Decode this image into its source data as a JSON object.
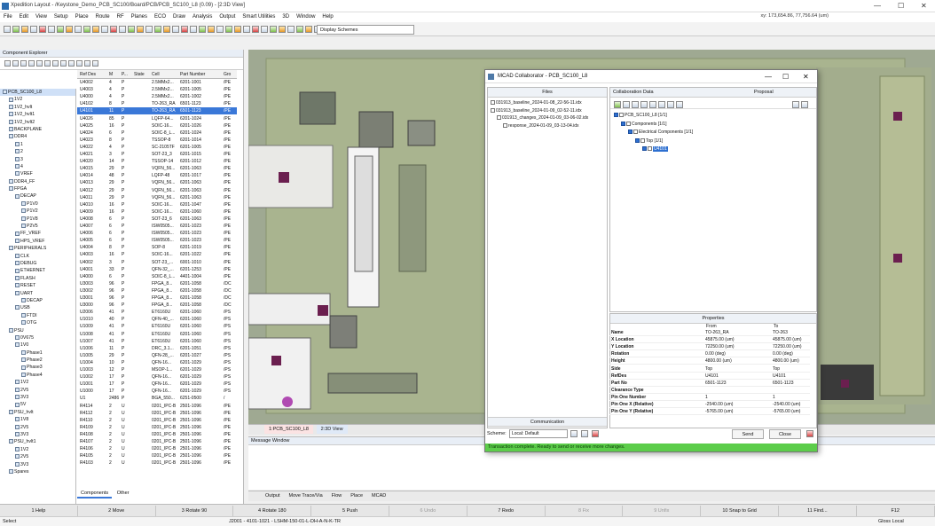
{
  "app": {
    "title": "Xpedition Layout - /Keystone_Demo_PCB_SC100/Board/PCB/PCB_SC100_L8 (0.09) - [2:3D View]",
    "coords": "xy: 173,654.86, 77,756.64 (um)",
    "min": "—",
    "max": "☐",
    "close": "✕"
  },
  "menu": [
    "File",
    "Edit",
    "View",
    "Setup",
    "Place",
    "Route",
    "RF",
    "Planes",
    "ECO",
    "Draw",
    "Analysis",
    "Output",
    "Smart Utilities",
    "3D",
    "Window",
    "Help"
  ],
  "toolbar": {
    "schemes": "Display Schemes"
  },
  "component_explorer": {
    "title": "Component Explorer",
    "tree": [
      {
        "label": "PCB_SC100_L8",
        "indent": 0,
        "selected": true
      },
      {
        "label": "1V2",
        "indent": 1
      },
      {
        "label": "1V2_hvlt",
        "indent": 1
      },
      {
        "label": "1V2_hvlt1",
        "indent": 1
      },
      {
        "label": "1V2_hvlt2",
        "indent": 1
      },
      {
        "label": "BACKPLANE",
        "indent": 1
      },
      {
        "label": "DDR4",
        "indent": 1
      },
      {
        "label": "1",
        "indent": 2
      },
      {
        "label": "2",
        "indent": 2
      },
      {
        "label": "3",
        "indent": 2
      },
      {
        "label": "4",
        "indent": 2
      },
      {
        "label": "VREF",
        "indent": 2
      },
      {
        "label": "DDR4_FF",
        "indent": 1
      },
      {
        "label": "FPGA",
        "indent": 1
      },
      {
        "label": "DECAP",
        "indent": 2
      },
      {
        "label": "P1V0",
        "indent": 3
      },
      {
        "label": "P1V2",
        "indent": 3
      },
      {
        "label": "P1V8",
        "indent": 3
      },
      {
        "label": "P2V5",
        "indent": 3
      },
      {
        "label": "FF_VREF",
        "indent": 2
      },
      {
        "label": "HPS_VREF",
        "indent": 2
      },
      {
        "label": "PERIPHERALS",
        "indent": 1
      },
      {
        "label": "CLK",
        "indent": 2
      },
      {
        "label": "DEBUG",
        "indent": 2
      },
      {
        "label": "ETHERNET",
        "indent": 2
      },
      {
        "label": "FLASH",
        "indent": 2
      },
      {
        "label": "RESET",
        "indent": 2
      },
      {
        "label": "UART",
        "indent": 2
      },
      {
        "label": "DECAP",
        "indent": 3
      },
      {
        "label": "USB",
        "indent": 2
      },
      {
        "label": "FTDI",
        "indent": 3
      },
      {
        "label": "OTG",
        "indent": 3
      },
      {
        "label": "PSU",
        "indent": 1
      },
      {
        "label": "0V675",
        "indent": 2
      },
      {
        "label": "1V0",
        "indent": 2
      },
      {
        "label": "Phase1",
        "indent": 3
      },
      {
        "label": "Phase2",
        "indent": 3
      },
      {
        "label": "Phase3",
        "indent": 3
      },
      {
        "label": "Phase4",
        "indent": 3
      },
      {
        "label": "1V2",
        "indent": 2
      },
      {
        "label": "2V5",
        "indent": 2
      },
      {
        "label": "3V3",
        "indent": 2
      },
      {
        "label": "5V",
        "indent": 2
      },
      {
        "label": "PSU_hvlt",
        "indent": 1
      },
      {
        "label": "1V8",
        "indent": 2
      },
      {
        "label": "2V5",
        "indent": 2
      },
      {
        "label": "3V3",
        "indent": 2
      },
      {
        "label": "PSU_hvlt1",
        "indent": 1
      },
      {
        "label": "1V2",
        "indent": 2
      },
      {
        "label": "2V5",
        "indent": 2
      },
      {
        "label": "3V3",
        "indent": 2
      },
      {
        "label": "Spares",
        "indent": 1
      }
    ],
    "columns": [
      "Ref Des",
      "M",
      "P...",
      "State",
      "Cell",
      "Part Number",
      "Gro"
    ],
    "rows": [
      [
        "U4002",
        "4",
        "P",
        "",
        "2.5MMx2...",
        "6201-1001",
        "/PE"
      ],
      [
        "U4003",
        "4",
        "P",
        "",
        "2.5MMx2...",
        "6201-1005",
        "/PE"
      ],
      [
        "U4000",
        "4",
        "P",
        "",
        "2.5MMx2...",
        "6201-1002",
        "/PE"
      ],
      [
        "U4102",
        "8",
        "P",
        "",
        "TO-263_RA",
        "6501-1123",
        "/PE"
      ],
      [
        "U4101",
        "11",
        "P",
        "",
        "TO-263_RA",
        "6501-1123",
        "/PE"
      ],
      [
        "U4026",
        "85",
        "P",
        "",
        "LQFP-64...",
        "6201-1024",
        "/PE"
      ],
      [
        "U4025",
        "16",
        "P",
        "",
        "SOIC-16...",
        "6201-1026",
        "/PE"
      ],
      [
        "U4024",
        "6",
        "P",
        "",
        "SOIC-8_L...",
        "6201-1024",
        "/PE"
      ],
      [
        "U4023",
        "8",
        "P",
        "",
        "TSSOP-8",
        "6201-1014",
        "/PE"
      ],
      [
        "U4022",
        "4",
        "P",
        "",
        "SC-2105TF",
        "6201-1005",
        "/PE"
      ],
      [
        "U4021",
        "3",
        "P",
        "",
        "SOT-23_3",
        "6201-1015",
        "/PE"
      ],
      [
        "U4020",
        "14",
        "P",
        "",
        "TSSOP-14",
        "6201-1012",
        "/PE"
      ],
      [
        "U4015",
        "29",
        "P",
        "",
        "VQFN_56...",
        "6201-1063",
        "/PE"
      ],
      [
        "U4014",
        "48",
        "P",
        "",
        "LQFP-48",
        "6201-1017",
        "/PE"
      ],
      [
        "U4013",
        "29",
        "P",
        "",
        "VQFN_56...",
        "6201-1063",
        "/PE"
      ],
      [
        "U4012",
        "29",
        "P",
        "",
        "VQFN_56...",
        "6201-1063",
        "/PE"
      ],
      [
        "U4011",
        "29",
        "P",
        "",
        "VQFN_56...",
        "6201-1063",
        "/PE"
      ],
      [
        "U4010",
        "16",
        "P",
        "",
        "SOIC-16...",
        "6201-1047",
        "/PE"
      ],
      [
        "U4009",
        "16",
        "P",
        "",
        "SOIC-16...",
        "6201-1060",
        "/PE"
      ],
      [
        "U4008",
        "6",
        "P",
        "",
        "SOT-23_6",
        "6201-1063",
        "/PE"
      ],
      [
        "U4007",
        "6",
        "P",
        "",
        "ISW0505...",
        "6201-1023",
        "/PE"
      ],
      [
        "U4006",
        "6",
        "P",
        "",
        "ISW0505...",
        "6201-1023",
        "/PE"
      ],
      [
        "U4005",
        "6",
        "P",
        "",
        "ISW0505...",
        "6201-1023",
        "/PE"
      ],
      [
        "U4004",
        "8",
        "P",
        "",
        "SOP-8",
        "6201-1019",
        "/PE"
      ],
      [
        "U4003",
        "16",
        "P",
        "",
        "SOIC-16...",
        "6201-1022",
        "/PE"
      ],
      [
        "U4002",
        "3",
        "P",
        "",
        "SOT-23_...",
        "6001-1010",
        "/PE"
      ],
      [
        "U4001",
        "33",
        "P",
        "",
        "QFN-32_...",
        "6201-1253",
        "/PE"
      ],
      [
        "U4000",
        "6",
        "P",
        "",
        "SOIC-8_L...",
        "4401-1004",
        "/PE"
      ],
      [
        "U3003",
        "96",
        "P",
        "",
        "FPGA_8...",
        "6201-1058",
        "/DC"
      ],
      [
        "U3002",
        "96",
        "P",
        "",
        "FPGA_8...",
        "6201-1058",
        "/DC"
      ],
      [
        "U3001",
        "96",
        "P",
        "",
        "FPGA_8...",
        "6201-1058",
        "/DC"
      ],
      [
        "U3000",
        "96",
        "P",
        "",
        "FPGA_8...",
        "6201-1058",
        "/DC"
      ],
      [
        "U2006",
        "41",
        "P",
        "",
        "ET6160U",
        "6201-1060",
        "/PS"
      ],
      [
        "U1010",
        "40",
        "P",
        "",
        "QFN-40_...",
        "6201-1060",
        "/PS"
      ],
      [
        "U1009",
        "41",
        "P",
        "",
        "ET6160U",
        "6201-1060",
        "/PS"
      ],
      [
        "U1008",
        "41",
        "P",
        "",
        "ET6160U",
        "6201-1060",
        "/PS"
      ],
      [
        "U1007",
        "41",
        "P",
        "",
        "ET6160U",
        "6201-1060",
        "/PS"
      ],
      [
        "U1006",
        "11",
        "P",
        "",
        "DRC_3.1...",
        "6201-1051",
        "/PS"
      ],
      [
        "U1005",
        "29",
        "P",
        "",
        "QFN-28_...",
        "6201-1027",
        "/PS"
      ],
      [
        "U1004",
        "10",
        "P",
        "",
        "QFN-16...",
        "6201-1029",
        "/PS"
      ],
      [
        "U1003",
        "12",
        "P",
        "",
        "MSOP-1...",
        "6201-1029",
        "/PS"
      ],
      [
        "U1002",
        "17",
        "P",
        "",
        "QFN-16...",
        "6201-1029",
        "/PS"
      ],
      [
        "U1001",
        "17",
        "P",
        "",
        "QFN-16...",
        "6201-1029",
        "/PS"
      ],
      [
        "U1000",
        "17",
        "P",
        "",
        "QFN-16...",
        "6201-1029",
        "/PS"
      ],
      [
        "U1",
        "2486",
        "P",
        "",
        "BGA_550...",
        "6251-0500",
        "/"
      ],
      [
        "R4114",
        "2",
        "U",
        "",
        "0201_IPC-B",
        "2501-1096",
        "/PE"
      ],
      [
        "R4112",
        "2",
        "U",
        "",
        "0201_IPC-B",
        "2501-1096",
        "/PE"
      ],
      [
        "R4110",
        "2",
        "U",
        "",
        "0201_IPC-B",
        "2501-1096",
        "/PE"
      ],
      [
        "R4109",
        "2",
        "U",
        "",
        "0201_IPC-B",
        "2501-1096",
        "/PE"
      ],
      [
        "R4108",
        "2",
        "U",
        "",
        "0201_IPC-B",
        "2501-1096",
        "/PE"
      ],
      [
        "R4107",
        "2",
        "U",
        "",
        "0201_IPC-B",
        "2501-1096",
        "/PE"
      ],
      [
        "R4106",
        "2",
        "U",
        "",
        "0201_IPC-B",
        "2501-1096",
        "/PE"
      ],
      [
        "R4105",
        "2",
        "U",
        "",
        "0201_IPC-B",
        "2501-1096",
        "/PE"
      ],
      [
        "R4103",
        "2",
        "U",
        "",
        "0201_IPC-B",
        "2501-1096",
        "/PE"
      ]
    ],
    "selected_row": 4,
    "tabs": [
      "Components",
      "Other"
    ]
  },
  "view_tabs": [
    "1:PCB_SC100_L8",
    "2:3D View"
  ],
  "message_window": {
    "title": "Message Window"
  },
  "bottom_tabs": [
    "Output",
    "Move Trace/Via",
    "Flow",
    "Place",
    "MCAD"
  ],
  "fkeys": [
    {
      "label": "1 Help",
      "dim": false
    },
    {
      "label": "2 Move",
      "dim": false
    },
    {
      "label": "3 Rotate 90",
      "dim": false
    },
    {
      "label": "4 Rotate 180",
      "dim": false
    },
    {
      "label": "5 Push",
      "dim": false
    },
    {
      "label": "6 Undo",
      "dim": true
    },
    {
      "label": "7 Redo",
      "dim": false
    },
    {
      "label": "8 Fix",
      "dim": true
    },
    {
      "label": "9 Unfix",
      "dim": true
    },
    {
      "label": "10 Snap to Grid",
      "dim": false
    },
    {
      "label": "11 Find...",
      "dim": false
    },
    {
      "label": "F12",
      "dim": false
    }
  ],
  "status": {
    "left": "Select",
    "middle": "J2001 - 4101-1021 - LSHM-150-01-L-DH-A-N-K-TR",
    "right": "Gloss Local"
  },
  "mcad": {
    "title": "MCAD Collaborator - PCB_SC100_L8",
    "files_header": "Files",
    "files": [
      {
        "label": "031913_baseline_2024-01-08_22-56-11.idx",
        "indent": 0
      },
      {
        "label": "031913_baseline_2024-01-09_02-52-11.idx",
        "indent": 0
      },
      {
        "label": "031913_changes_2024-01-09_03-06-02.idx",
        "indent": 1
      },
      {
        "label": "response_2024-01-09_03-13-04.idx",
        "indent": 2
      }
    ],
    "collab_header": "Collaboration Data",
    "proposal": "Proposal",
    "collab_tree": [
      {
        "label": "PCB_SC100_L8 [1/1]",
        "indent": 0
      },
      {
        "label": "Components [1/1]",
        "indent": 1
      },
      {
        "label": "Electrical Components [1/1]",
        "indent": 2
      },
      {
        "label": "Top [1/1]",
        "indent": 3
      },
      {
        "label": "U4101",
        "indent": 4,
        "selected": true
      }
    ],
    "properties_header": "Properties",
    "prop_cols": {
      "from": "From",
      "to": "To"
    },
    "properties": [
      {
        "name": "Name",
        "from": "TO-263_RA",
        "to": "TO-263"
      },
      {
        "name": "X Location",
        "from": "45875.00 (um)",
        "to": "45875.00 (um)"
      },
      {
        "name": "Y Location",
        "from": "72250.00 (um)",
        "to": "72250.00 (um)"
      },
      {
        "name": "Rotation",
        "from": "0.00 (deg)",
        "to": "0.00 (deg)"
      },
      {
        "name": "Height",
        "from": "4800.00 (um)",
        "to": "4800.00 (um)"
      },
      {
        "name": "Side",
        "from": "Top",
        "to": "Top"
      },
      {
        "name": "RefDes",
        "from": "U4101",
        "to": "U4101"
      },
      {
        "name": "Part No",
        "from": "6501-1123",
        "to": "6501-1123"
      },
      {
        "name": "Clearance Type",
        "from": "",
        "to": ""
      },
      {
        "name": "Pin One Number",
        "from": "1",
        "to": "1"
      },
      {
        "name": "Pin One X (Relative)",
        "from": "-2540.00 (um)",
        "to": "-2540.00 (um)"
      },
      {
        "name": "Pin One Y (Relative)",
        "from": "-5765.00 (um)",
        "to": "-5765.00 (um)"
      }
    ],
    "communication": "Communication",
    "scheme_label": "Scheme:",
    "scheme_value": "Local: Default",
    "send": "Send",
    "close": "Close",
    "status": "Transaction complete. Ready to send or receive more changes."
  }
}
